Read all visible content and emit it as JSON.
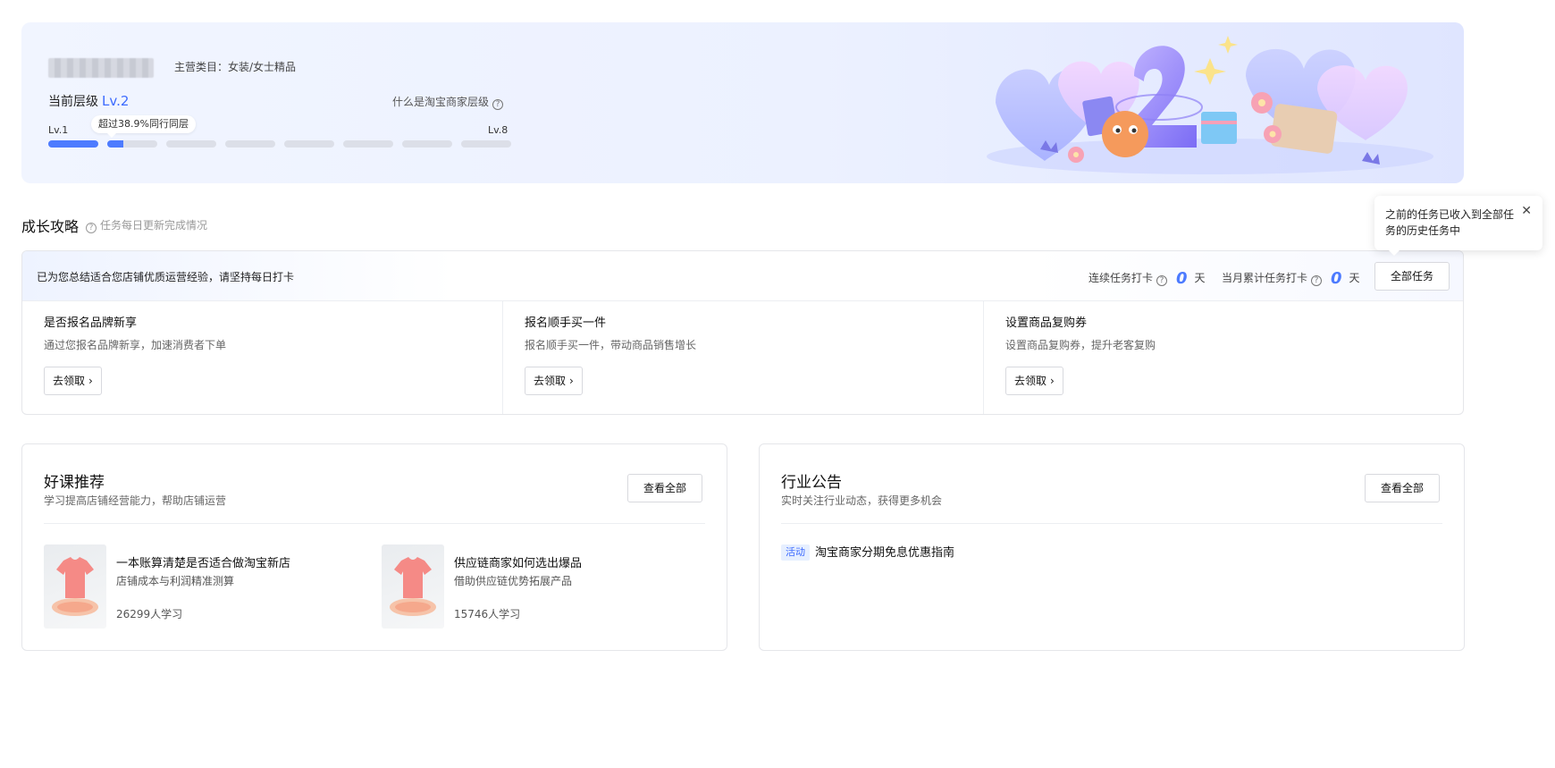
{
  "hero": {
    "main_category": "主营类目：女装/女士精品",
    "level_label": "当前层级",
    "level_value": "Lv.2",
    "what_is_level": "什么是淘宝商家层级",
    "progress_bubble": "超过38.9%同行同层",
    "level_min": "Lv.1",
    "level_max": "Lv.8",
    "current_level_progress": 0.32
  },
  "growth": {
    "title": "成长攻略",
    "subtitle": "任务每日更新完成情况",
    "tooltip": "之前的任务已收入到全部任务的历史任务中",
    "hint": "已为您总结适合您店铺优质运营经验，请坚持每日打卡",
    "streak_label": "连续任务打卡",
    "streak_value": "0",
    "monthly_label": "当月累计任务打卡",
    "monthly_value": "0",
    "day_unit": "天",
    "all_tasks_btn": "全部任务",
    "tasks": [
      {
        "title": "是否报名品牌新享",
        "desc": "通过您报名品牌新享，加速消费者下单",
        "btn": "去领取"
      },
      {
        "title": "报名顺手买一件",
        "desc": "报名顺手买一件，带动商品销售增长",
        "btn": "去领取"
      },
      {
        "title": "设置商品复购券",
        "desc": "设置商品复购券，提升老客复购",
        "btn": "去领取"
      }
    ]
  },
  "courses": {
    "title": "好课推荐",
    "subtitle": "学习提高店铺经营能力，帮助店铺运营",
    "view_all": "查看全部",
    "items": [
      {
        "title": "一本账算清楚是否适合做淘宝新店",
        "desc": "店铺成本与利润精准测算",
        "count": "26299人学习"
      },
      {
        "title": "供应链商家如何选出爆品",
        "desc": "借助供应链优势拓展产品",
        "count": "15746人学习"
      }
    ]
  },
  "notices": {
    "title": "行业公告",
    "subtitle": "实时关注行业动态，获得更多机会",
    "view_all": "查看全部",
    "items": [
      {
        "tag": "活动",
        "text": "淘宝商家分期免息优惠指南"
      }
    ]
  },
  "colors": {
    "accent": "#4d7bff",
    "track": "#dcdfe8"
  }
}
